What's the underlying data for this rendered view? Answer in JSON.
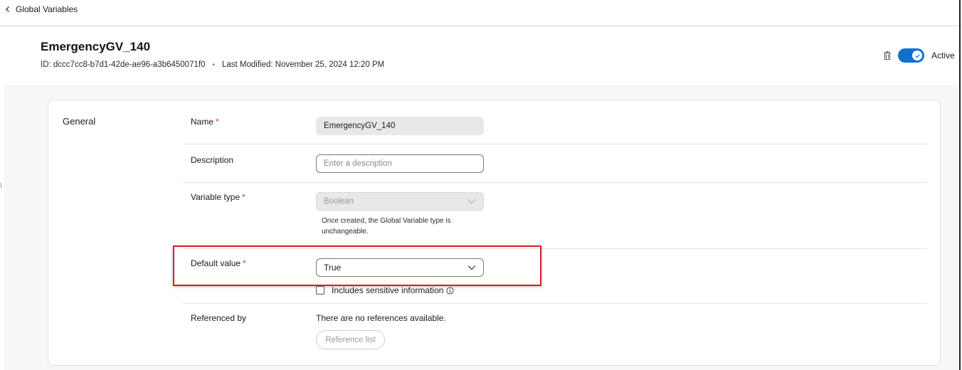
{
  "nav": {
    "back_label": "Global Variables"
  },
  "header": {
    "title": "EmergencyGV_140",
    "id_label": "ID:",
    "id_value": "dccc7cc8-b7d1-42de-ae96-a3b6450071f0",
    "separator": "•",
    "modified_label": "Last Modified:",
    "modified_value": "November 25, 2024 12:20 PM",
    "status_label": "Active"
  },
  "section": {
    "title": "General"
  },
  "fields": {
    "name": {
      "label": "Name",
      "required": "*",
      "value": "EmergencyGV_140"
    },
    "description": {
      "label": "Description",
      "placeholder": "Enter a description"
    },
    "variable_type": {
      "label": "Variable type",
      "required": "*",
      "value": "Boolean",
      "help": "Once created, the Global Variable type is unchangeable."
    },
    "default_value": {
      "label": "Default value",
      "required": "*",
      "value": "True",
      "sensitive_label": "Includes sensitive information"
    },
    "referenced_by": {
      "label": "Referenced by",
      "empty_text": "There are no references available.",
      "button_label": "Reference list"
    }
  },
  "colors": {
    "accent": "#1170cf",
    "required": "#d4371c",
    "highlight": "#d9201a"
  }
}
